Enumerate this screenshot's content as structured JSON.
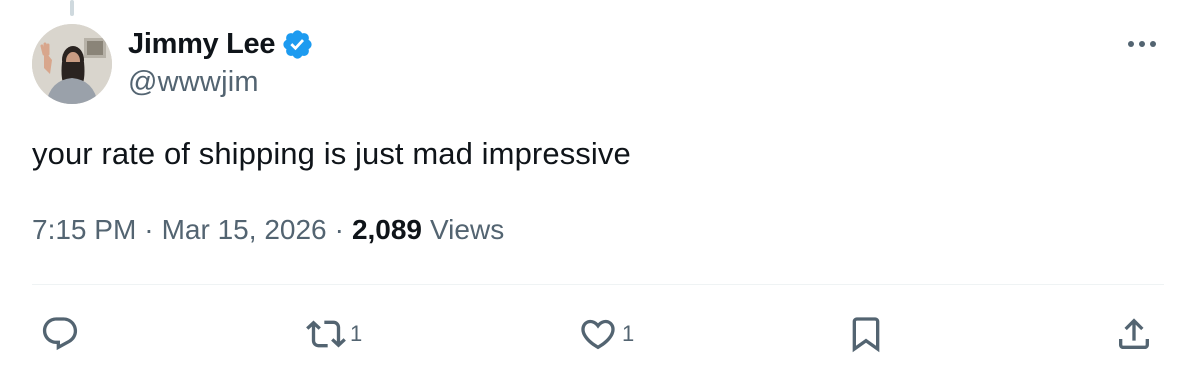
{
  "tweet": {
    "author": {
      "display_name": "Jimmy Lee",
      "handle": "@wwwjim",
      "verified": true
    },
    "text": "your rate of shipping is just mad impressive",
    "time": "7:15 PM",
    "separator": "·",
    "date": "Mar 15, 2026",
    "views_count": "2,089",
    "views_label": "Views"
  },
  "actions": {
    "reply_count": "",
    "repost_count": "1",
    "like_count": "1"
  },
  "colors": {
    "text_primary": "#0f1419",
    "text_secondary": "#536471",
    "verified_blue": "#1d9bf0",
    "divider": "#eff3f4"
  },
  "icons": [
    "verified-badge-icon",
    "more-icon",
    "reply-icon",
    "repost-icon",
    "like-icon",
    "bookmark-icon",
    "share-icon"
  ]
}
